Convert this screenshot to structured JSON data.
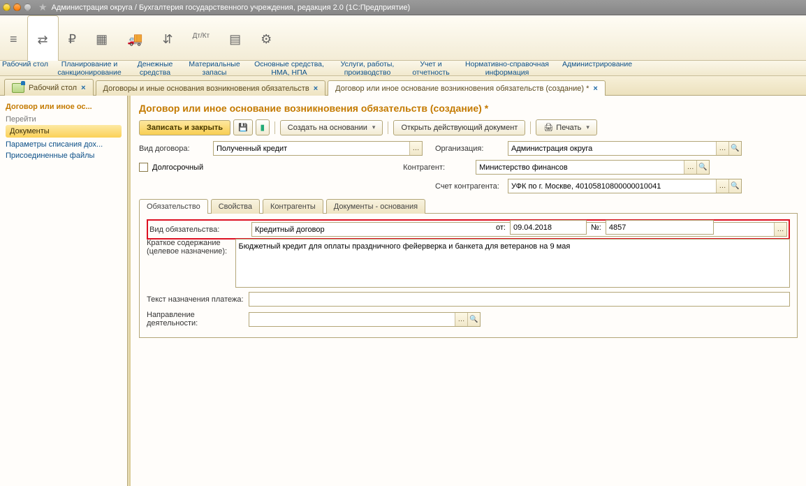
{
  "window": {
    "title": "Администрация округа / Бухгалтерия государственного учреждения, редакция 2.0  (1С:Предприятие)"
  },
  "mainmenu": [
    {
      "label": "Рабочий\nстол",
      "icon": "≡"
    },
    {
      "label": "Планирование и\nсанкционирование",
      "icon": "⇄"
    },
    {
      "label": "Денежные\nсредства",
      "icon": "₽"
    },
    {
      "label": "Материальные\nзапасы",
      "icon": "▦"
    },
    {
      "label": "Основные средства,\nНМА, НПА",
      "icon": "🚚"
    },
    {
      "label": "Услуги, работы,\nпроизводство",
      "icon": "⇵"
    },
    {
      "label": "Учет и\nотчетность",
      "icon": "Дт/Кт"
    },
    {
      "label": "Нормативно-справочная\nинформация",
      "icon": "▤"
    },
    {
      "label": "Администрирование",
      "icon": "⚙"
    }
  ],
  "tabs": [
    {
      "label": "Рабочий стол"
    },
    {
      "label": "Договоры и иные основания возникновения обязательств"
    },
    {
      "label": "Договор или иное основание возникновения обязательств (создание) *"
    }
  ],
  "sidebar": {
    "headline": "Договор или иное ос...",
    "section_nav": "Перейти",
    "active": "Документы",
    "links": [
      "Параметры списания дох...",
      "Присоединенные файлы"
    ]
  },
  "page": {
    "title": "Договор или иное основание возникновения обязательств (создание) *",
    "toolbar": {
      "save_close": "Записать и закрыть",
      "create_based": "Создать на основании",
      "open_current": "Открыть действующий документ",
      "print": "Печать"
    },
    "labels": {
      "vid_dog": "Вид договора:",
      "dolgo": "Долгосрочный",
      "org": "Организация:",
      "kontr": "Контрагент:",
      "schet": "Счет контрагента:",
      "vid_ob": "Вид обязательства:",
      "ot": "от:",
      "num": "№:",
      "kratkoe": "Краткое содержание\n(целевое назначение):",
      "tekst": "Текст назначения платежа:",
      "napr": "Направление деятельности:"
    },
    "values": {
      "vid_dog": "Полученный кредит",
      "org": "Администрация округа",
      "kontr": "Министерство финансов",
      "schet": "УФК по г. Москве, 40105810800000010041",
      "vid_ob": "Кредитный договор",
      "date": "09.04.2018",
      "num": "4857",
      "kratkoe": "Бюджетный кредит для оплаты праздничного фейерверка и банкета для ветеранов на 9 мая",
      "tekst": "",
      "napr": ""
    },
    "subtabs": [
      "Обязательство",
      "Свойства",
      "Контрагенты",
      "Документы - основания"
    ]
  }
}
